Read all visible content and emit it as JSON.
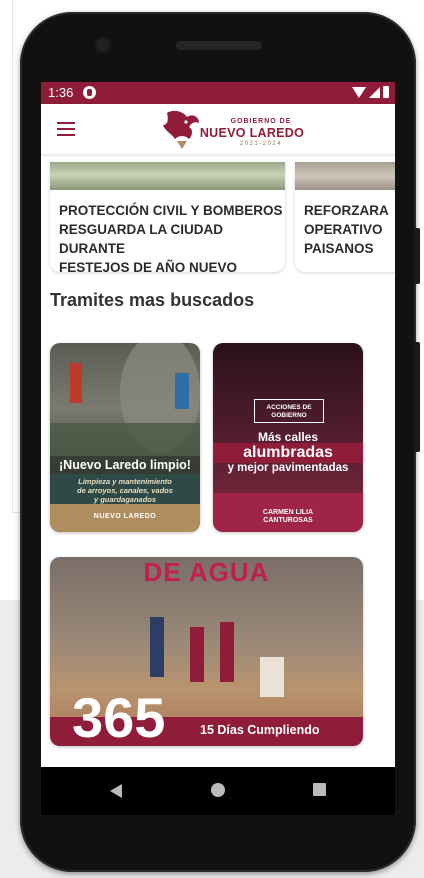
{
  "statusbar": {
    "time": "1:36"
  },
  "header": {
    "logo_line1": "GOBIERNO DE",
    "logo_line2": "NUEVO LAREDO",
    "logo_line3": "2021-2024"
  },
  "news": [
    {
      "title": "PROTECCIÓN CIVIL Y BOMBEROS\nRESGUARDA LA CIUDAD DURANTE\nFESTEJOS DE AÑO NUEVO"
    },
    {
      "title": "REFORZARA\nOPERATIVO\nPAISANOS"
    }
  ],
  "section": {
    "title": "Tramites mas buscados"
  },
  "tramites": {
    "t1": {
      "headline": "¡Nuevo Laredo limpio!",
      "subtitle": "Limpieza y mantenimiento\nde arroyos, canales, vados\ny guardaganados",
      "logo": "NUEVO LAREDO"
    },
    "t2": {
      "badge": "ACCIONES DE GOBIERNO",
      "line1": "Más calles",
      "line2": "alumbradas",
      "line3": "y mejor pavimentadas",
      "sign": "CARMEN LILIA\nCANTUROSAS"
    },
    "t3": {
      "headline": "DE AGUA",
      "number": "365",
      "text": "15 Días Cumpliendo"
    }
  },
  "colors": {
    "brand": "#8f1d3a",
    "gold": "#b08d5e"
  },
  "icons": {
    "menu": "hamburger-icon",
    "fab": "mail-icon",
    "nav": [
      "back-icon",
      "home-icon",
      "recent-apps-icon"
    ]
  }
}
